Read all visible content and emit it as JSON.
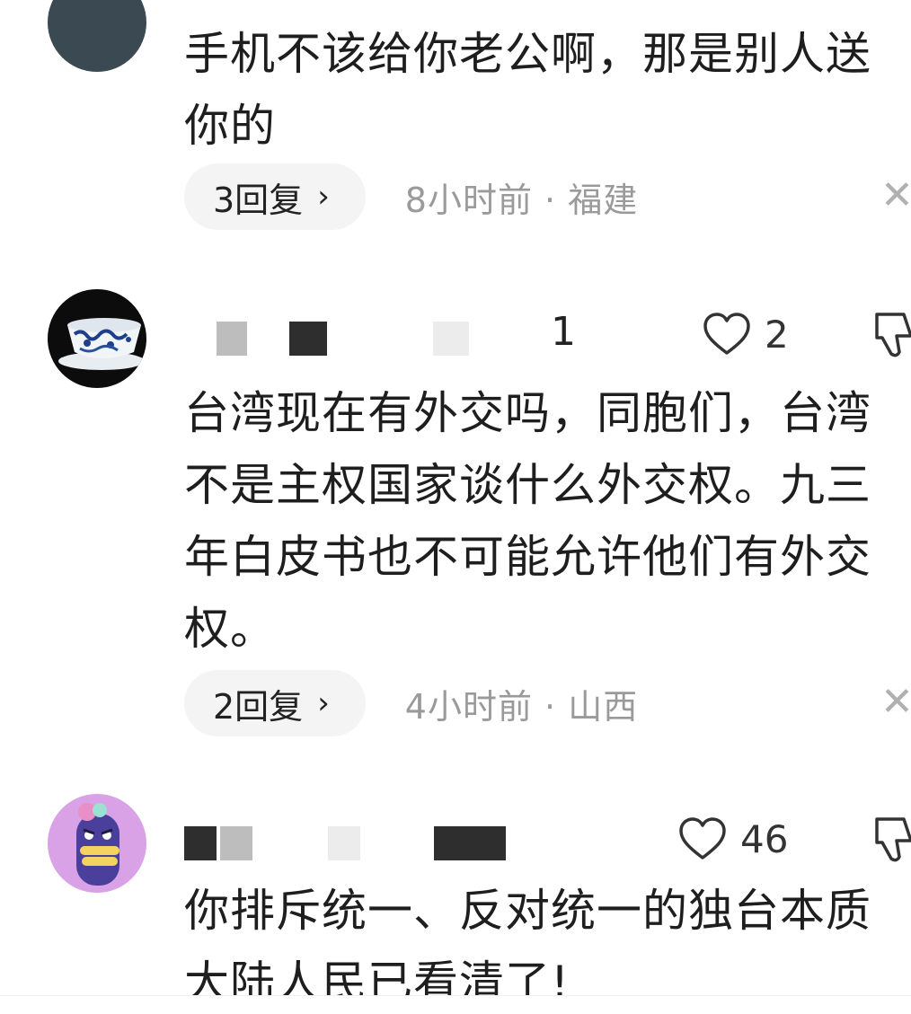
{
  "comments": [
    {
      "text": "手机不该给你老公啊，那是别人送你的",
      "reply_label": "3回复",
      "time_location": "8小时前 · 福建"
    },
    {
      "name_suffix": "1",
      "likes": "2",
      "text": "台湾现在有外交吗，同胞们，台湾不是主权国家谈什么外交权。九三年白皮书也不可能允许他们有外交权。",
      "reply_label": "2回复",
      "time_location": "4小时前 · 山西"
    },
    {
      "likes": "46",
      "text": "你排斥统一、反对统一的独台本质大陆人民已看清了!"
    }
  ],
  "icons": {
    "like": "heart-outline-icon",
    "dislike": "thumbs-down-icon",
    "close": "close-icon",
    "chevron": "chevron-right-icon"
  },
  "colors": {
    "text": "#1e1e1e",
    "meta": "#9a9a9a",
    "pill_bg": "#f4f4f4",
    "avatar3_bg": "#d9a2e6",
    "avatar3_figure": "#4b3f9c"
  }
}
